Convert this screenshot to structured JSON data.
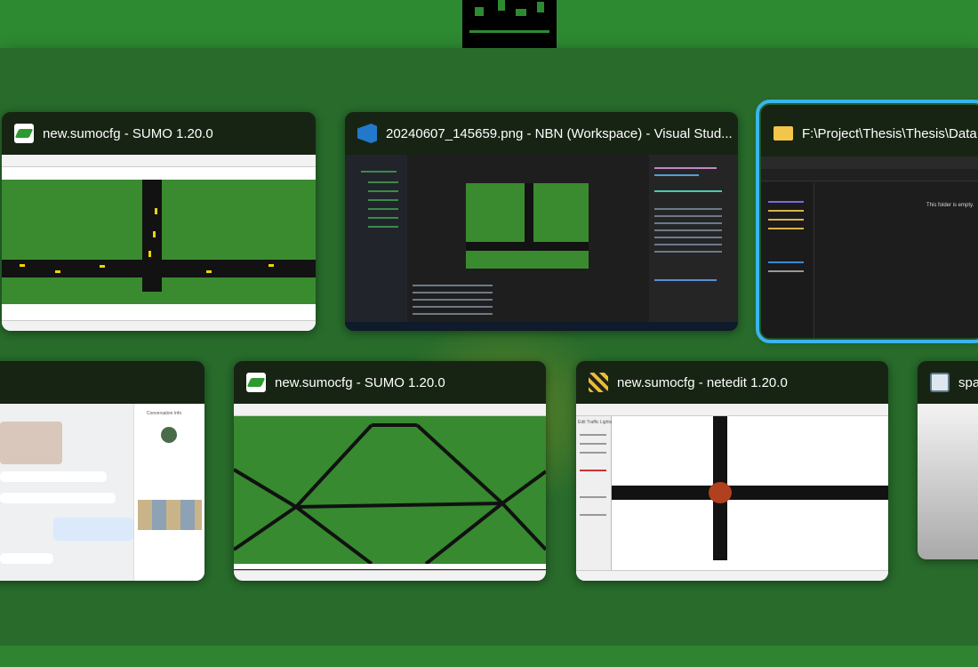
{
  "windows": [
    {
      "title": "new.sumocfg - SUMO 1.20.0",
      "icon": "sumo-icon"
    },
    {
      "title": "20240607_145659.png - NBN (Workspace) - Visual Stud...",
      "icon": "vscode-icon"
    },
    {
      "title": "F:\\Project\\Thesis\\Thesis\\Data",
      "icon": "folder-icon",
      "selected": true,
      "empty_message": "This folder is empty."
    },
    {
      "title": "",
      "icon": "chat-app",
      "panel_title": "Conversation Info"
    },
    {
      "title": "new.sumocfg - SUMO 1.20.0",
      "icon": "sumo-icon"
    },
    {
      "title": "new.sumocfg - netedit 1.20.0",
      "icon": "netedit-icon",
      "panel_title": "Edit Traffic Lights"
    },
    {
      "title": "spa",
      "icon": "image-icon"
    }
  ],
  "colors": {
    "accent": "#3ab4ee",
    "desktop": "#2f8432",
    "card_header": "#172413"
  }
}
